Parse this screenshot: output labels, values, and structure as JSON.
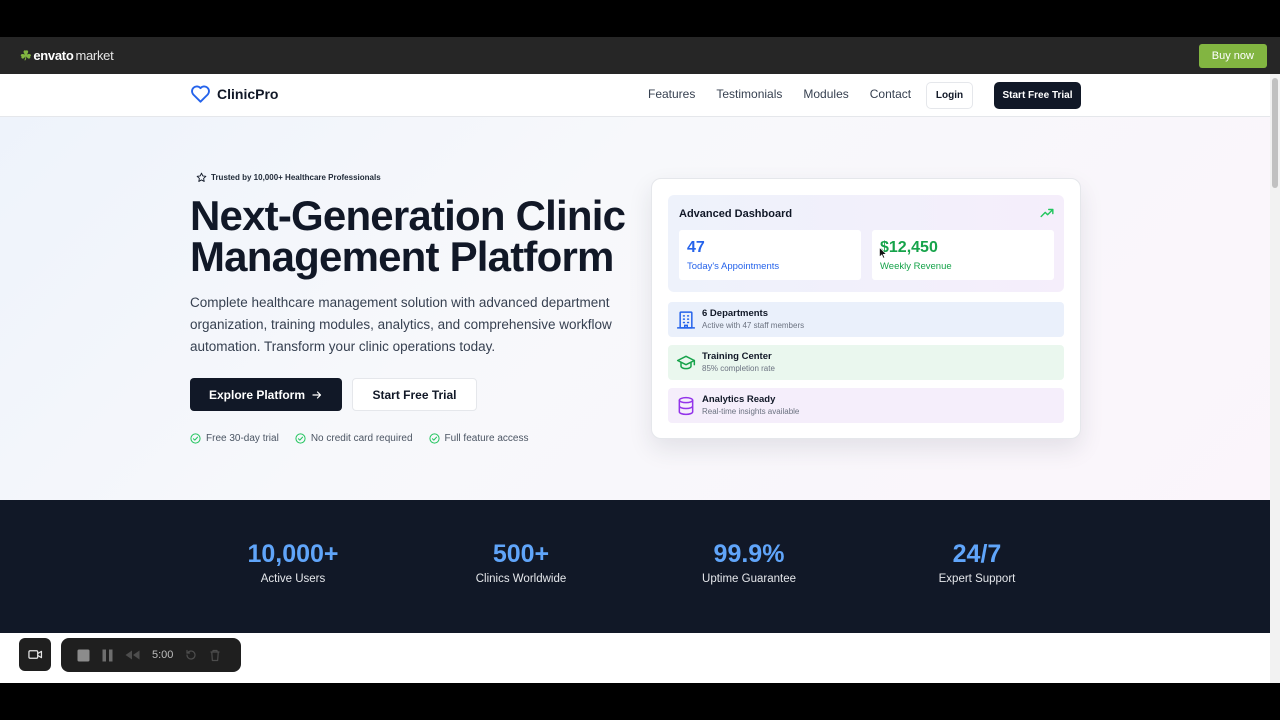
{
  "envato": {
    "logo_main": "envato",
    "logo_sub": "market",
    "buy_label": "Buy now"
  },
  "nav": {
    "brand": "ClinicPro",
    "links": [
      "Features",
      "Testimonials",
      "Modules",
      "Contact"
    ],
    "login": "Login",
    "cta": "Start Free Trial"
  },
  "hero": {
    "badge": "Trusted by 10,000+ Healthcare Professionals",
    "headline_line1": "Next-Generation Clinic",
    "headline_line2": "Management Platform",
    "subhead": "Complete healthcare management solution with advanced department organization, training modules, analytics, and comprehensive workflow automation. Transform your clinic operations today.",
    "primary_btn": "Explore Platform",
    "secondary_btn": "Start Free Trial",
    "perks": [
      "Free 30-day trial",
      "No credit card required",
      "Full feature access"
    ]
  },
  "dashboard": {
    "title": "Advanced Dashboard",
    "stats": [
      {
        "value": "47",
        "label": "Today's Appointments",
        "color": "#2563eb"
      },
      {
        "value": "$12,450",
        "label": "Weekly Revenue",
        "color": "#16a34a"
      }
    ],
    "rows": [
      {
        "title": "6 Departments",
        "subtitle": "Active with 47 staff members",
        "icon": "building-icon",
        "bg": "#eaf0fb",
        "color": "#2563eb"
      },
      {
        "title": "Training Center",
        "subtitle": "85% completion rate",
        "icon": "graduation-cap-icon",
        "bg": "#eaf7ee",
        "color": "#16a34a"
      },
      {
        "title": "Analytics Ready",
        "subtitle": "Real-time insights available",
        "icon": "database-icon",
        "bg": "#f5eefb",
        "color": "#9333ea"
      }
    ]
  },
  "stats_band": [
    {
      "value": "10,000+",
      "label": "Active Users"
    },
    {
      "value": "500+",
      "label": "Clinics Worldwide"
    },
    {
      "value": "99.9%",
      "label": "Uptime Guarantee"
    },
    {
      "value": "24/7",
      "label": "Expert Support"
    }
  ],
  "recorder": {
    "time": "5:00"
  },
  "colors": {
    "accent": "#111827",
    "stat_blue": "#60a5fa",
    "envato_green": "#82b541"
  }
}
